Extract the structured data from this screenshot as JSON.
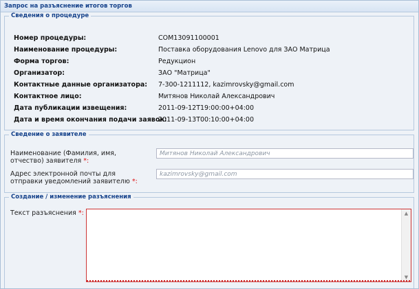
{
  "window": {
    "title": "Запрос на разъяснение итогов торгов"
  },
  "procedure": {
    "legend": "Сведения о процедуре",
    "rows": [
      {
        "label": "Номер процедуры:",
        "value": "COM13091100001"
      },
      {
        "label": "Наименование процедуры:",
        "value": "Поставка оборудования Lenovo для ЗАО Матрица"
      },
      {
        "label": "Форма торгов:",
        "value": "Редукцион"
      },
      {
        "label": "Организатор:",
        "value": "ЗАО \"Матрица\""
      },
      {
        "label": "Контактные данные организатора:",
        "value": "7-300-1211112, kazimrovsky@gmail.com"
      },
      {
        "label": "Контактное лицо:",
        "value": "Митянов Николай Александрович"
      },
      {
        "label": "Дата публикации извещения:",
        "value": "2011-09-12T19:00:00+04:00"
      },
      {
        "label": "Дата и время окончания подачи заявок:",
        "value": "2011-09-13T00:10:00+04:00"
      }
    ]
  },
  "applicant": {
    "legend": "Сведение о заявителе",
    "name_label": "Наименование (Фамилия, имя, отчество) заявителя",
    "name_placeholder": "Митянов Николай Александрович",
    "email_label": "Адрес электронной почты для отправки уведомлений заявителю",
    "email_placeholder": "kazimrovsky@gmail.com",
    "required_mark": "*:"
  },
  "clarification": {
    "legend": "Создание / изменение разъяснения",
    "text_label": "Текст разъяснения",
    "required_mark": "*:",
    "text_value": ""
  }
}
